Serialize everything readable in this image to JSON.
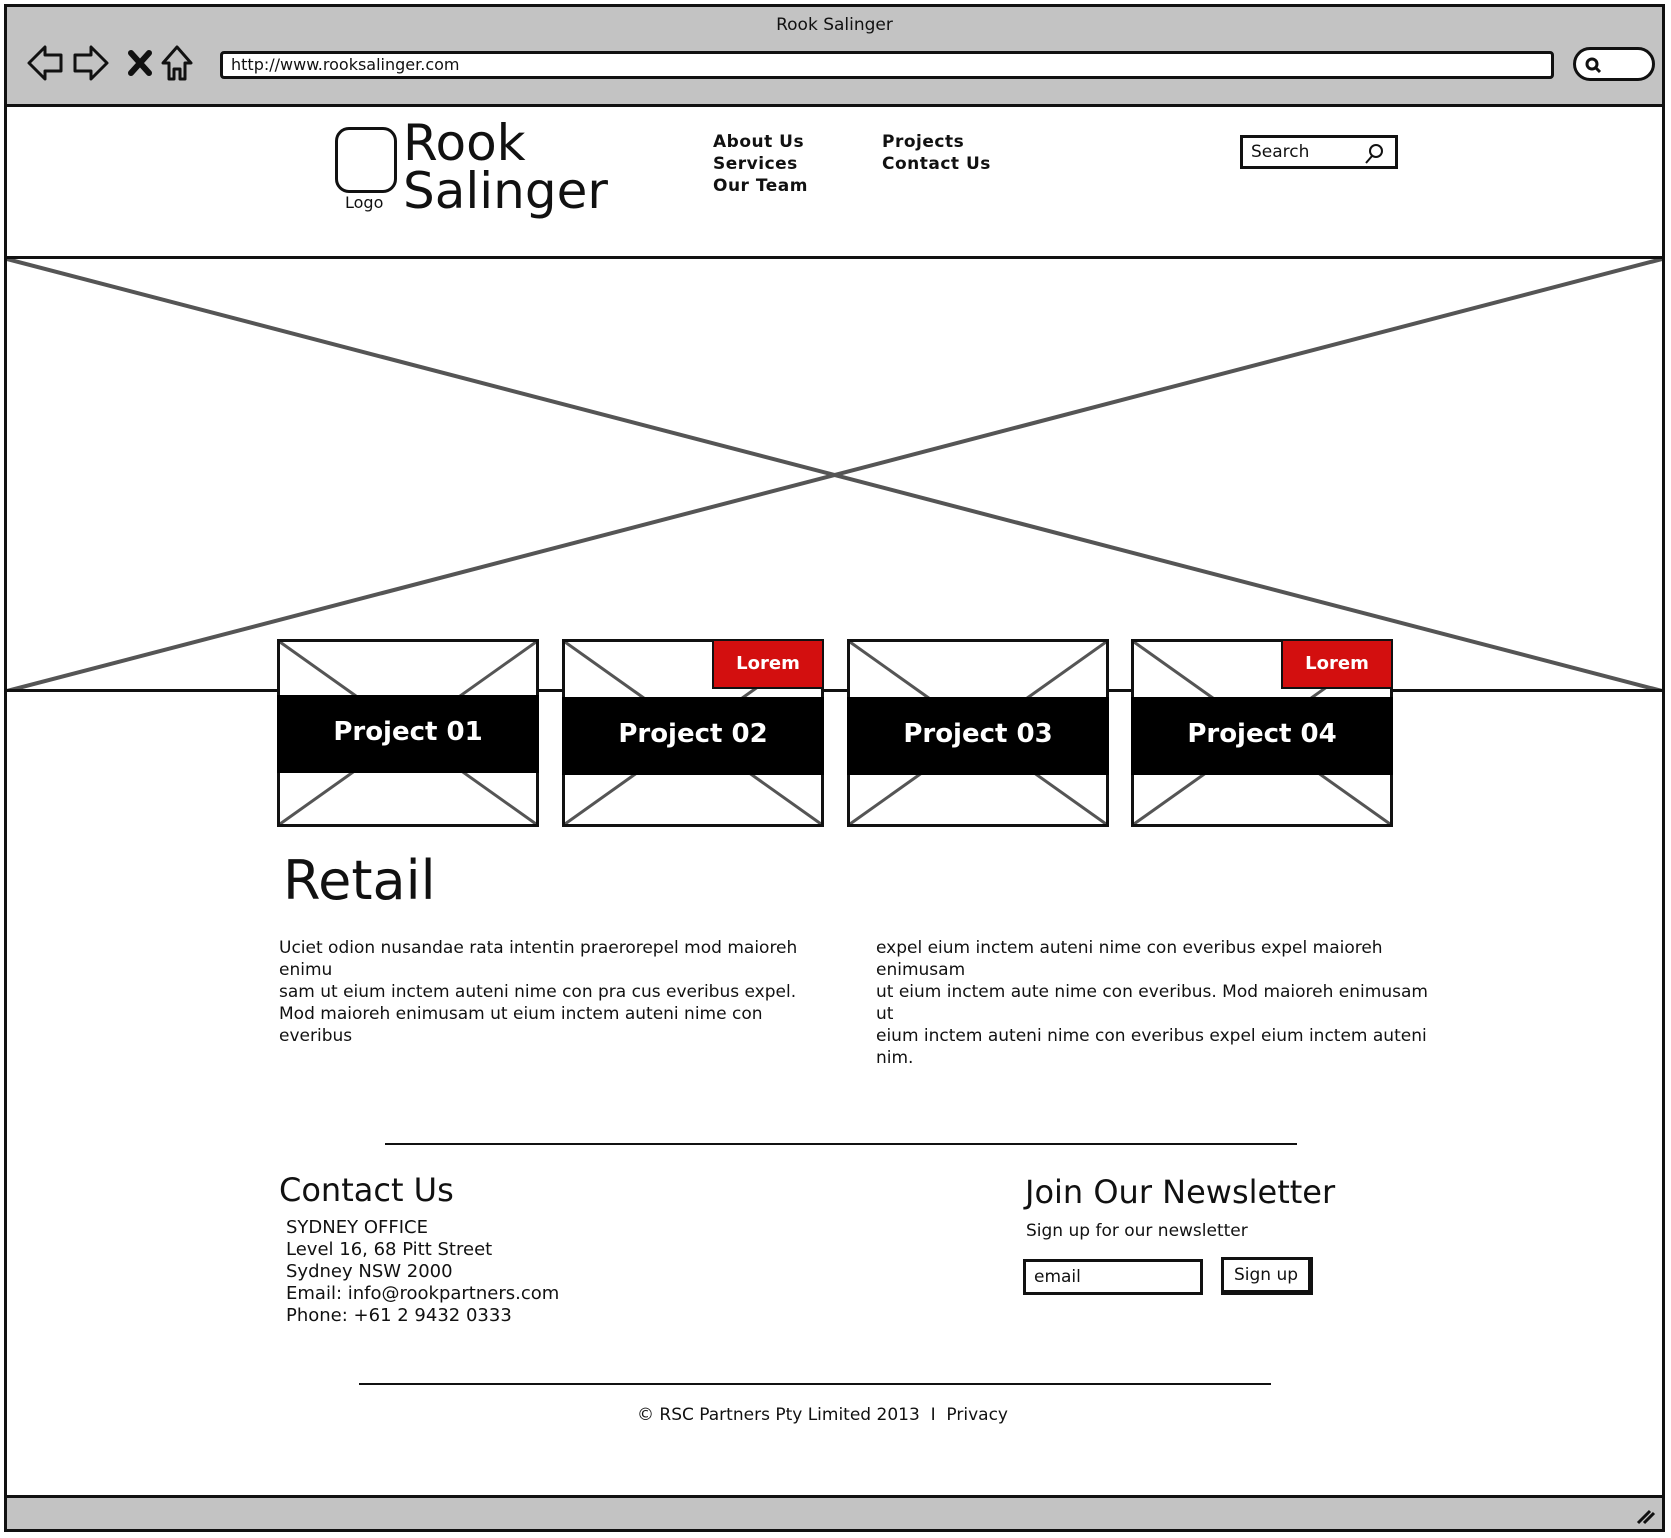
{
  "window": {
    "title": "Rook Salinger"
  },
  "browser": {
    "url": "http://www.rooksalinger.com"
  },
  "header": {
    "logo_label": "Logo",
    "brand_line1": "Rook",
    "brand_line2": "Salinger",
    "menu_col1": [
      "About Us",
      "Services",
      "Our Team"
    ],
    "menu_col2": [
      "Projects",
      "Contact Us"
    ],
    "search_placeholder": "Search"
  },
  "projects": [
    {
      "title": "Project 01",
      "badge": ""
    },
    {
      "title": "Project 02",
      "badge": "Lorem"
    },
    {
      "title": "Project 03",
      "badge": ""
    },
    {
      "title": "Project 04",
      "badge": "Lorem"
    }
  ],
  "main": {
    "heading": "Retail",
    "para_left": [
      "Uciet odion nusandae rata intentin praerorepel mod maioreh enimu",
      "sam ut eium inctem auteni nime con pra cus everibus expel.",
      "Mod maioreh enimusam ut eium inctem auteni nime con everibus"
    ],
    "para_right": [
      "expel eium inctem auteni nime con everibus expel maioreh enimusam",
      "ut eium inctem aute nime con everibus. Mod maioreh enimusam ut",
      "eium inctem auteni nime con everibus expel eium inctem auteni nim."
    ]
  },
  "contact": {
    "heading": "Contact Us",
    "lines": [
      "SYDNEY OFFICE",
      "Level 16, 68 Pitt Street",
      "Sydney NSW 2000",
      "Email: info@rookpartners.com",
      "Phone: +61 2 9432 0333"
    ]
  },
  "newsletter": {
    "heading": "Join Our Newsletter",
    "subtext": "Sign up for our newsletter",
    "email_placeholder": "email",
    "button": "Sign up"
  },
  "footer": {
    "copyright": "© RSC Partners Pty Limited 2013",
    "separator": "I",
    "privacy": "Privacy"
  },
  "colors": {
    "chrome": "#c3c3c3",
    "badge": "#d30f0f",
    "band": "#000000"
  }
}
